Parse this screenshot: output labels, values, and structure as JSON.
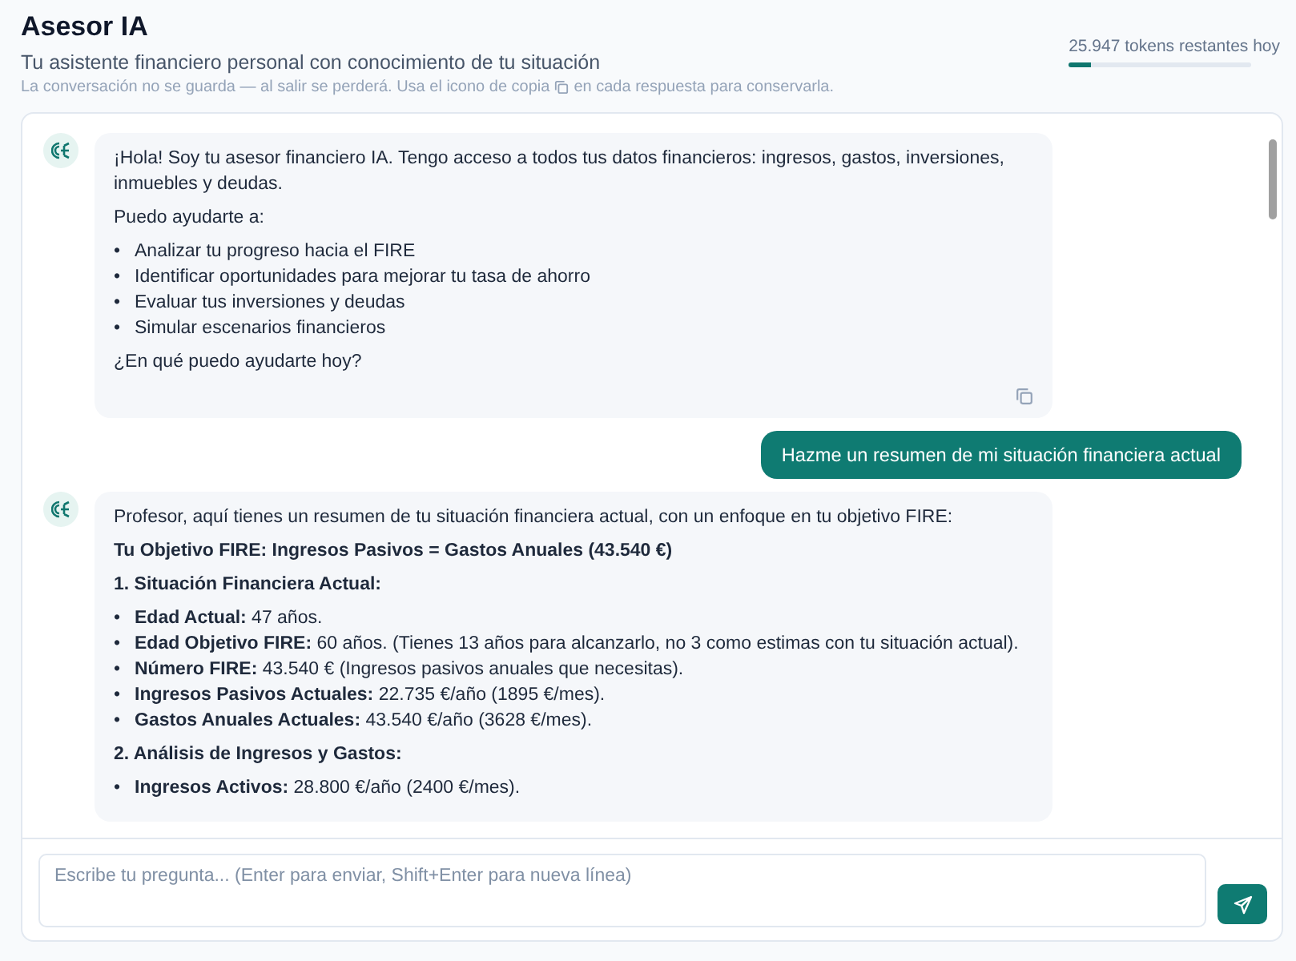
{
  "header": {
    "title": "Asesor IA",
    "subtitle": "Tu asistente financiero personal con conocimiento de tu situación",
    "note_before": "La conversación no se guarda — al salir se perderá. Usa el icono de copia",
    "note_after": "en cada respuesta para conservarla."
  },
  "tokens": {
    "label": "25.947 tokens restantes hoy",
    "level": 0.12
  },
  "messages": [
    {
      "kind": "assistant",
      "blocks": [
        {
          "kind": "paragraph",
          "text": "¡Hola! Soy tu asesor financiero IA. Tengo acceso a todos tus datos financieros: ingresos, gastos, inversiones, inmuebles y deudas."
        },
        {
          "kind": "paragraph",
          "text": "Puedo ayudarte a:"
        },
        {
          "kind": "list",
          "marker": "•",
          "items": [
            "Analizar tu progreso hacia el FIRE",
            "Identificar oportunidades para mejorar tu tasa de ahorro",
            "Evaluar tus inversiones y deudas",
            "Simular escenarios financieros"
          ]
        },
        {
          "kind": "paragraph",
          "text": "¿En qué puedo ayudarte hoy?"
        }
      ]
    },
    {
      "kind": "user",
      "blocks": [
        {
          "kind": "paragraph",
          "text": "Hazme un resumen de mi situación financiera actual"
        }
      ]
    },
    {
      "kind": "assistant",
      "blocks": [
        {
          "kind": "paragraph",
          "text": "Profesor, aquí tienes un resumen de tu situación financiera actual, con un enfoque en tu objetivo FIRE:"
        },
        {
          "kind": "heading",
          "text": "Tu Objetivo FIRE: Ingresos Pasivos = Gastos Anuales (43.540 €)"
        },
        {
          "kind": "heading",
          "text": "1. Situación Financiera Actual:"
        },
        {
          "kind": "list",
          "marker": "•",
          "items": [
            "**Edad Actual:** 47 años.",
            "**Edad Objetivo FIRE:** 60 años. (Tienes 13 años para alcanzarlo, no 3 como estimas con tu situación actual).",
            "**Número FIRE:** 43.540 € (Ingresos pasivos anuales que necesitas).",
            "**Ingresos Pasivos Actuales:** 22.735 €/año (1895 €/mes).",
            "**Gastos Anuales Actuales:** 43.540 €/año (3628 €/mes)."
          ]
        },
        {
          "kind": "heading",
          "text": "2. Análisis de Ingresos y Gastos:"
        },
        {
          "kind": "list",
          "marker": "•",
          "items": [
            "**Ingresos Activos:** 28.800 €/año (2400 €/mes)."
          ]
        }
      ]
    }
  ],
  "composer": {
    "placeholder": "Escribe tu pregunta... (Enter para enviar, Shift+Enter para nueva línea)"
  }
}
